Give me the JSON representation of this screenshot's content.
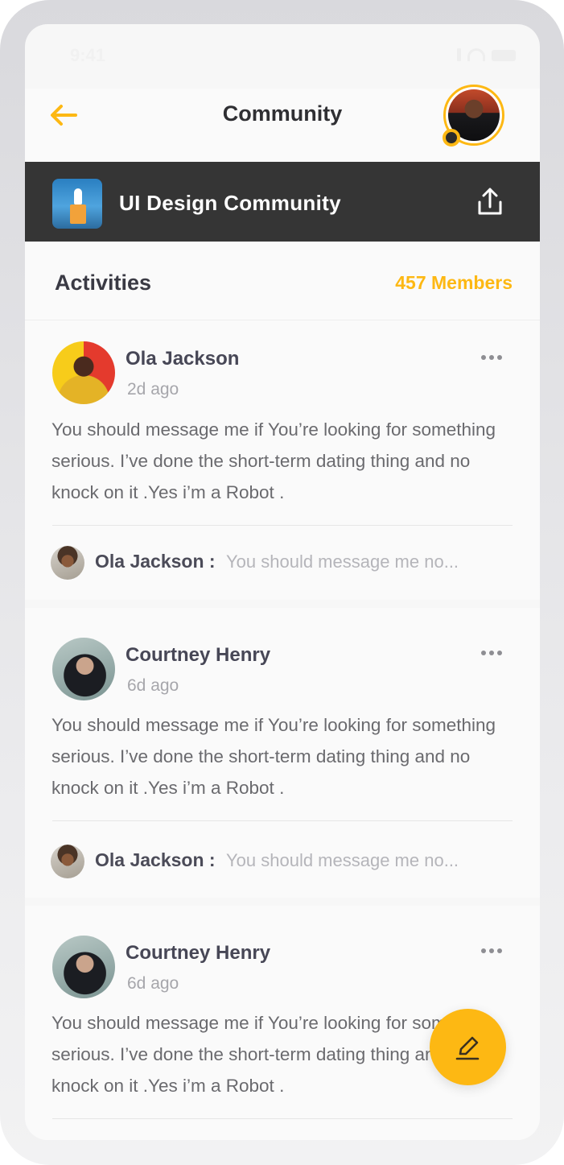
{
  "status_bar": {
    "time": "9:41"
  },
  "header": {
    "title": "Community",
    "back_icon": "arrow-left-icon",
    "accent_color": "#fdb813"
  },
  "community": {
    "name": "UI Design Community",
    "share_icon": "share-icon",
    "banner_color": "#353535"
  },
  "activities": {
    "title": "Activities",
    "members": "457 Members"
  },
  "posts": [
    {
      "author": "Ola Jackson",
      "time": "2d ago",
      "body": "You should message me if You’re looking for something serious. I’ve done the short-term dating thing and no knock on it .Yes i’m a Robot .",
      "comment": {
        "author": "Ola Jackson :",
        "text": "You should message me no..."
      }
    },
    {
      "author": "Courtney Henry",
      "time": "6d ago",
      "body": "You should message me if You’re looking for something serious. I’ve done the short-term dating thing and no knock on it .Yes i’m a Robot .",
      "comment": {
        "author": "Ola Jackson :",
        "text": "You should message me no..."
      }
    },
    {
      "author": "Courtney Henry",
      "time": "6d ago",
      "body": "You should message me if You’re looking for something serious. I’ve done the short-term dating thing and no knock on it .Yes i’m a Robot ."
    }
  ],
  "fab": {
    "icon": "pencil-icon"
  }
}
